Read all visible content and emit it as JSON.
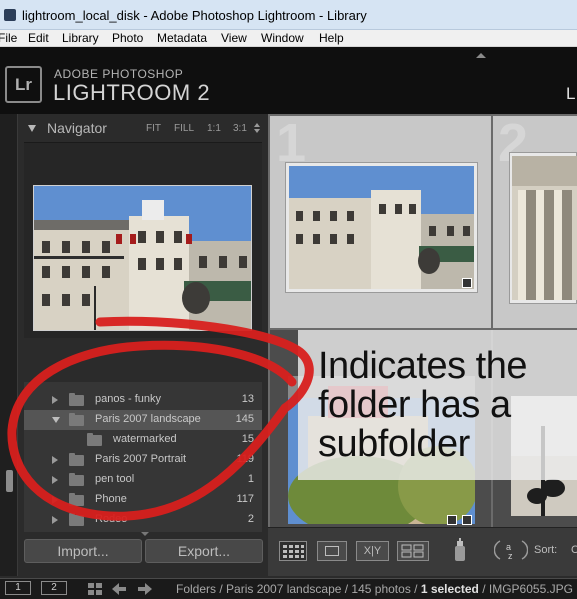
{
  "window": {
    "title": "lightroom_local_disk - Adobe Photoshop Lightroom - Library"
  },
  "menu": [
    "File",
    "Edit",
    "Library",
    "Photo",
    "Metadata",
    "View",
    "Window",
    "Help"
  ],
  "identity": {
    "badge": "Lr",
    "line1": "ADOBE PHOTOSHOP",
    "line2": "LIGHTROOM 2",
    "module": "L"
  },
  "navigator": {
    "title": "Navigator",
    "options": [
      "FIT",
      "FILL",
      "1:1",
      "3:1"
    ]
  },
  "folders": [
    {
      "name": "panos - funky",
      "count": "13",
      "state": "closed",
      "indent": 0
    },
    {
      "name": "Paris 2007 landscape",
      "count": "145",
      "state": "open",
      "indent": 0,
      "selected": true
    },
    {
      "name": "watermarked",
      "count": "15",
      "state": "none",
      "indent": 1
    },
    {
      "name": "Paris 2007 Portrait",
      "count": "119",
      "state": "closed",
      "indent": 0
    },
    {
      "name": "pen tool",
      "count": "1",
      "state": "closed",
      "indent": 0
    },
    {
      "name": "Phone",
      "count": "117",
      "state": "closed",
      "indent": 0
    },
    {
      "name": "Rodeo",
      "count": "2",
      "state": "closed",
      "indent": 0
    }
  ],
  "buttons": {
    "import": "Import...",
    "export": "Export..."
  },
  "grid": {
    "cell1": "1",
    "cell2": "2"
  },
  "callout": {
    "lines": [
      "Indicates the",
      "folder has a",
      "subfolder"
    ]
  },
  "toolbar": {
    "sort_label": "Sort:",
    "sort_value": "C",
    "xy": "X|Y"
  },
  "filmstrip": {
    "screen1": "1",
    "screen2": "2",
    "path_prefix": "Folders / Paris 2007 landscape / 145 photos / ",
    "selected": "1 selected",
    "path_suffix": " / IMGP6055.JPG"
  },
  "colors": {
    "annotation_red": "#d8201e",
    "selection": "#555555"
  }
}
